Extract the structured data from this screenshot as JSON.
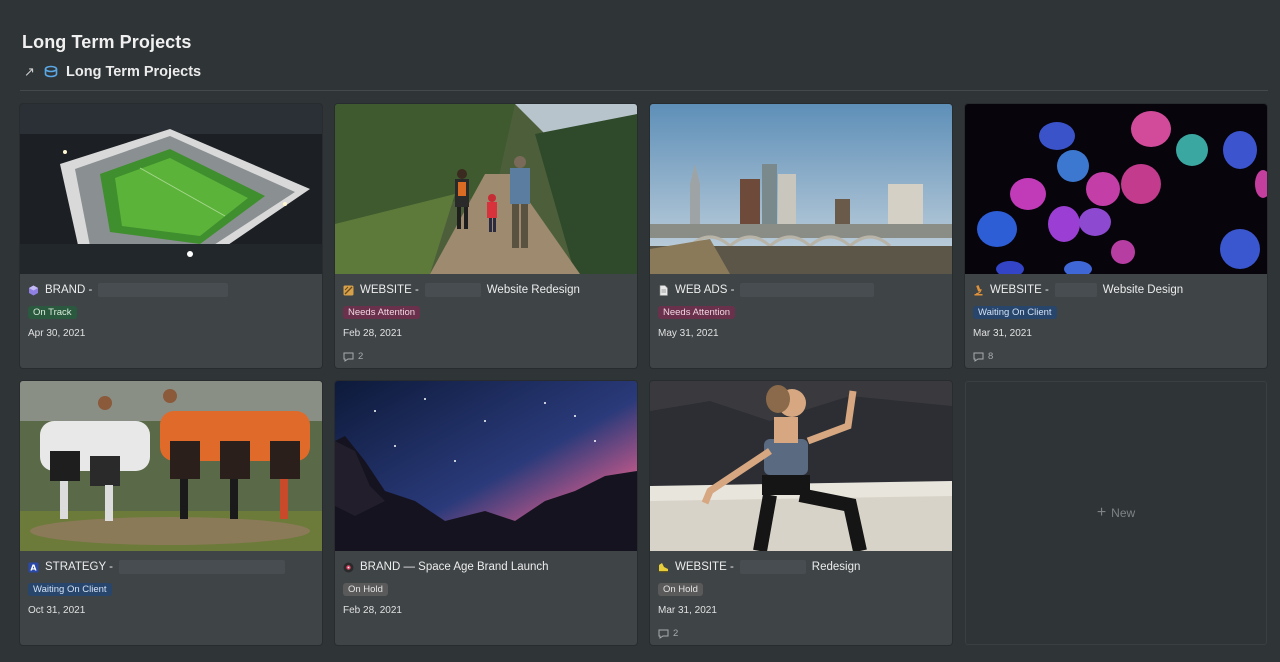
{
  "page": {
    "title": "Long Term Projects"
  },
  "view": {
    "label": "Long Term Projects",
    "arrow": "↗"
  },
  "cards": [
    {
      "prefix": "BRAND - ",
      "suffix": "",
      "tag": "On Track",
      "date": "Apr 30, 2021",
      "comments": ""
    },
    {
      "prefix": "WEBSITE - ",
      "suffix": "Website Redesign",
      "tag": "Needs Attention",
      "date": "Feb 28, 2021",
      "comments": "2"
    },
    {
      "prefix": "WEB ADS - ",
      "suffix": "",
      "tag": "Needs Attention",
      "date": "May 31, 2021",
      "comments": ""
    },
    {
      "prefix": "WEBSITE - ",
      "suffix": "Website Design",
      "tag": "Waiting On Client",
      "date": "Mar 31, 2021",
      "comments": "8"
    },
    {
      "prefix": "STRATEGY - ",
      "suffix": "",
      "tag": "Waiting On Client",
      "date": "Oct 31, 2021",
      "comments": ""
    },
    {
      "prefix": "BRAND — Space Age Brand Launch",
      "suffix": "",
      "tag": "On Hold",
      "date": "Feb 28, 2021",
      "comments": ""
    },
    {
      "prefix": "WEBSITE - ",
      "suffix": "Redesign",
      "tag": "On Hold",
      "date": "Mar 31, 2021",
      "comments": "2"
    }
  ],
  "new_card": {
    "label": "New",
    "plus": "+"
  },
  "colors": {
    "tag_on_track": "#2b593f",
    "tag_needs_attention": "#69314c",
    "tag_waiting": "#28456c",
    "tag_on_hold": "#5a5a5a"
  }
}
